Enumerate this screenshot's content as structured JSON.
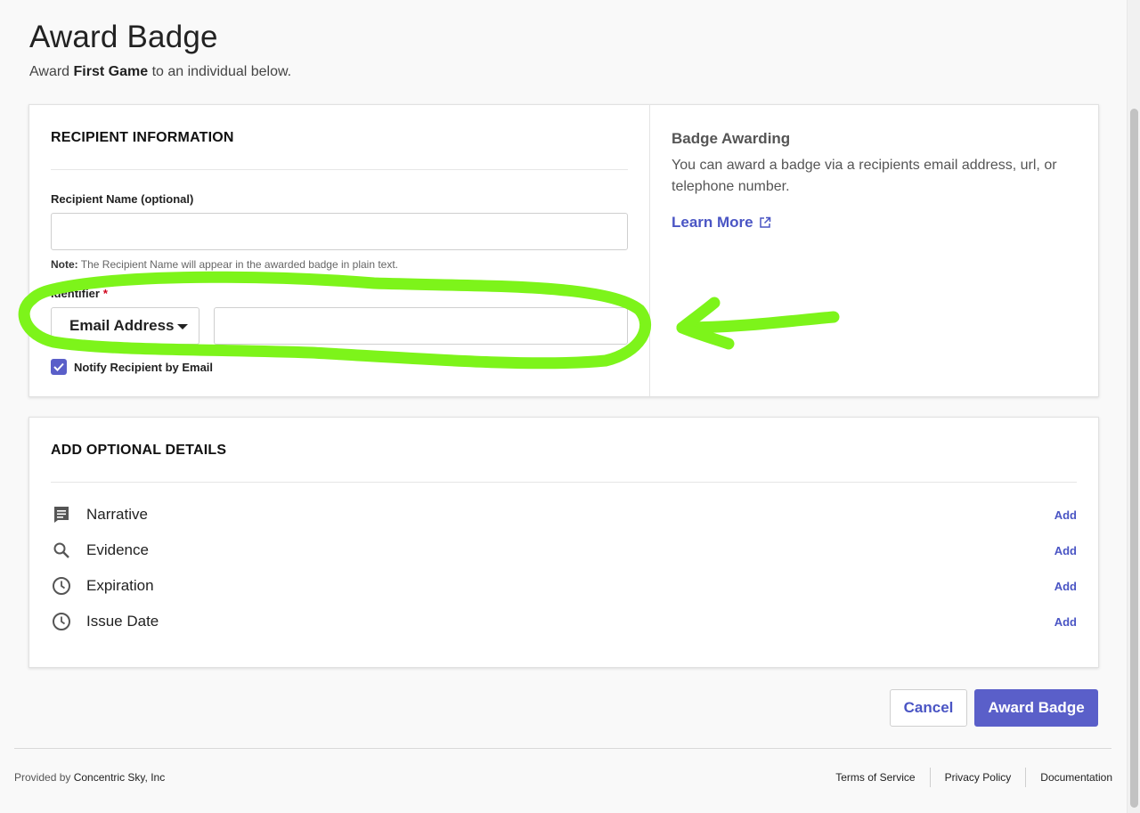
{
  "header": {
    "title": "Award Badge",
    "subtitle_prefix": "Award",
    "badge_name": "First Game",
    "subtitle_suffix": "to an individual below."
  },
  "recipient": {
    "section_title": "RECIPIENT INFORMATION",
    "name_label": "Recipient Name (optional)",
    "name_value": "",
    "note_label": "Note:",
    "note_text": "The Recipient Name will appear in the awarded badge in plain text.",
    "identifier_label": "Identifier",
    "required_mark": "*",
    "identifier_type": "Email Address",
    "identifier_value": "",
    "notify_label": "Notify Recipient by Email",
    "notify_checked": true
  },
  "aside": {
    "title": "Badge Awarding",
    "text": "You can award a badge via a recipients email address, url, or telephone number.",
    "learn_more": "Learn More"
  },
  "optional_details": {
    "section_title": "ADD OPTIONAL DETAILS",
    "items": [
      {
        "label": "Narrative",
        "icon": "narrative-icon",
        "action": "Add"
      },
      {
        "label": "Evidence",
        "icon": "search-icon",
        "action": "Add"
      },
      {
        "label": "Expiration",
        "icon": "clock-icon",
        "action": "Add"
      },
      {
        "label": "Issue Date",
        "icon": "clock-icon",
        "action": "Add"
      }
    ]
  },
  "actions": {
    "cancel": "Cancel",
    "award": "Award Badge"
  },
  "footer": {
    "provided_by": "Provided by",
    "company": "Concentric Sky, Inc",
    "links": [
      "Terms of Service",
      "Privacy Policy",
      "Documentation"
    ]
  },
  "colors": {
    "accent": "#5a5fc9",
    "link": "#4a55c4",
    "required": "#d0021b",
    "annotation": "#7df41a"
  }
}
